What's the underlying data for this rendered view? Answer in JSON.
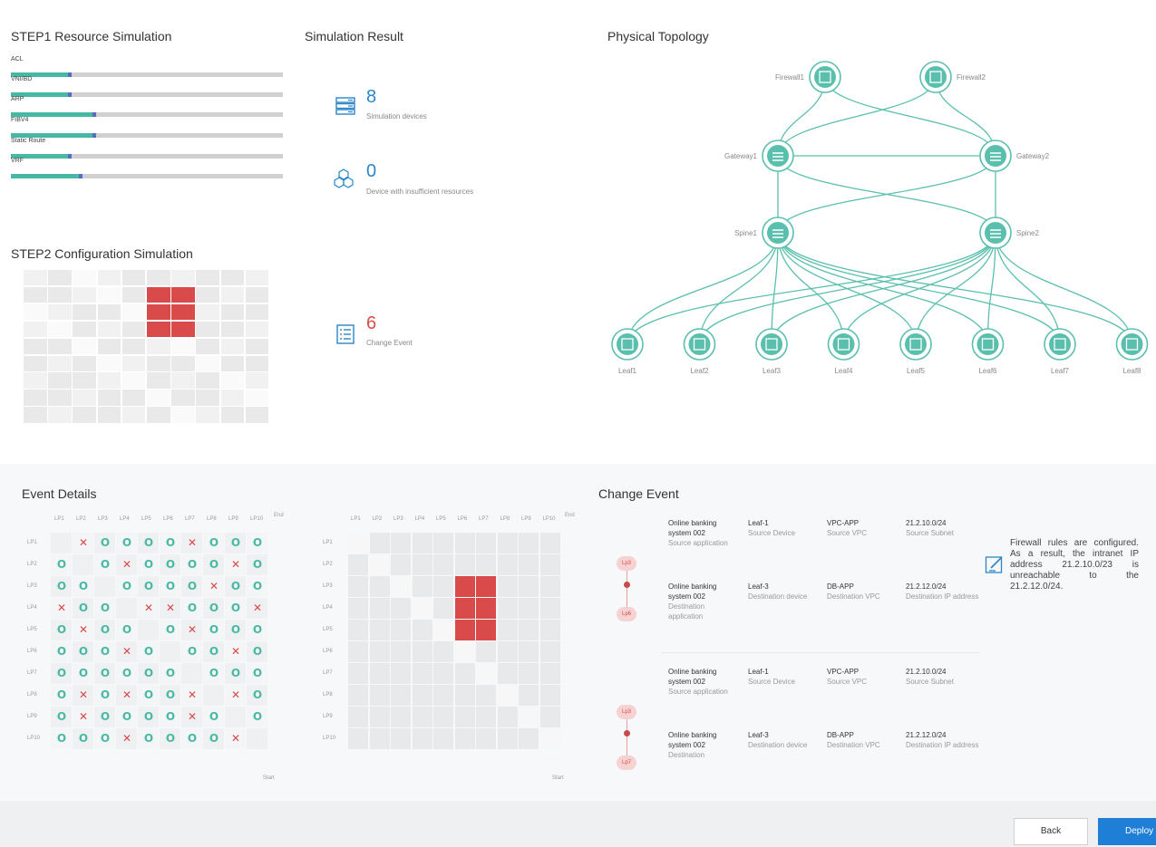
{
  "step1": {
    "title": "STEP1 Resource Simulation",
    "resources": [
      {
        "label": "ACL",
        "fill": 0.21,
        "marker": 0.21
      },
      {
        "label": "VNI/BD",
        "fill": 0.21,
        "marker": 0.21
      },
      {
        "label": "ARP",
        "fill": 0.3,
        "marker": 0.3
      },
      {
        "label": "FIBV4",
        "fill": 0.3,
        "marker": 0.3
      },
      {
        "label": "Static Route",
        "fill": 0.21,
        "marker": 0.21
      },
      {
        "label": "VRF",
        "fill": 0.25,
        "marker": 0.25
      }
    ]
  },
  "step2": {
    "title": "STEP2 Configuration Simulation"
  },
  "result": {
    "title": "Simulation Result",
    "devices": {
      "value": "8",
      "label": "Simulation devices",
      "icon": "server-icon"
    },
    "insufficient": {
      "value": "0",
      "label": "Device with insufficient resources",
      "icon": "cubes-icon"
    },
    "changes": {
      "value": "6",
      "label": "Change Event",
      "icon": "list-icon"
    }
  },
  "topology": {
    "title": "Physical Topology",
    "firewalls": [
      "Firewall1",
      "Firewall2"
    ],
    "gateways": [
      "Gateway1",
      "Gateway2"
    ],
    "spines": [
      "Spine1",
      "Spine2"
    ],
    "leaves": [
      "Leaf1",
      "Leaf2",
      "Leaf3",
      "Leaf4",
      "Leaf5",
      "Leaf6",
      "Leaf7",
      "Leaf8"
    ]
  },
  "event_details": {
    "title": "Event Details",
    "headers": [
      "LP1",
      "LP2",
      "LP3",
      "LP4",
      "LP5",
      "LP6",
      "LP7",
      "LP8",
      "LP9",
      "LP10"
    ],
    "end_label": "End",
    "start_label": "Start",
    "matrix": [
      [
        "",
        "x",
        "o",
        "o",
        "o",
        "o",
        "x",
        "o",
        "o",
        "o"
      ],
      [
        "o",
        "",
        "o",
        "x",
        "o",
        "o",
        "o",
        "o",
        "x",
        "o"
      ],
      [
        "o",
        "o",
        "",
        "o",
        "o",
        "o",
        "o",
        "x",
        "o",
        "o"
      ],
      [
        "x",
        "o",
        "o",
        "",
        "x",
        "x",
        "o",
        "o",
        "o",
        "x"
      ],
      [
        "o",
        "x",
        "o",
        "o",
        "",
        "o",
        "x",
        "o",
        "o",
        "o"
      ],
      [
        "o",
        "o",
        "o",
        "x",
        "o",
        "",
        "o",
        "o",
        "x",
        "o"
      ],
      [
        "o",
        "o",
        "o",
        "o",
        "o",
        "o",
        "",
        "o",
        "o",
        "o"
      ],
      [
        "o",
        "x",
        "o",
        "x",
        "o",
        "o",
        "x",
        "",
        "x",
        "o"
      ],
      [
        "o",
        "x",
        "o",
        "o",
        "o",
        "o",
        "x",
        "o",
        "",
        "o"
      ],
      [
        "o",
        "o",
        "o",
        "x",
        "o",
        "o",
        "o",
        "o",
        "x",
        ""
      ]
    ]
  },
  "change_event": {
    "title": "Change Event",
    "groups": [
      {
        "from_badge": "Lp3",
        "to_badge": "Lp6",
        "rows": [
          [
            "Online banking system 002",
            "Source application",
            "Leaf-1",
            "Source Device",
            "VPC-APP",
            "Source VPC",
            "21.2.10.0/24",
            "Source Subnet"
          ],
          [
            "Online banking system 002",
            "Destination application",
            "Leaf-3",
            "Destination device",
            "DB-APP",
            "Destination VPC",
            "21.2.12.0/24",
            "Destination IP address"
          ]
        ]
      },
      {
        "from_badge": "Lp3",
        "to_badge": "Lp7",
        "rows": [
          [
            "Online banking system 002",
            "Source application",
            "Leaf-1",
            "Source Device",
            "VPC-APP",
            "Source VPC",
            "21.2.10.0/24",
            "Source Subnet"
          ],
          [
            "Online banking system 002",
            "Destination",
            "Leaf-3",
            "Destination device",
            "DB-APP",
            "Destination VPC",
            "21.2.12.0/24",
            "Destination IP address"
          ]
        ]
      }
    ],
    "note": "Firewall rules are configured. As a result, the intranet IP address 21.2.10.0/23 is unreachable to the 21.2.12.0/24.",
    "note_icon": "edit-note-icon"
  },
  "footer": {
    "back_label": "Back",
    "deploy_label": "Deploy"
  },
  "colors": {
    "accent": "#1f7fd6",
    "teal": "#46b8a4",
    "red": "#d94a4a",
    "topo": "#5bbfae"
  }
}
